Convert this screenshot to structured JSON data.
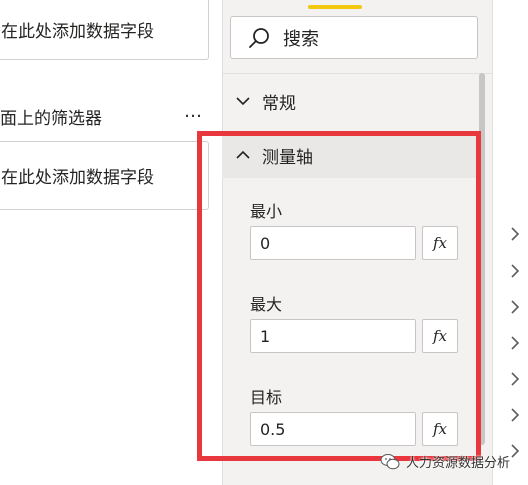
{
  "filters_pane": {
    "drop_zone_1": "在此处添加数据字段",
    "section_title": "面上的筛选器",
    "more_label": "…",
    "drop_zone_2": "在此处添加数据字段"
  },
  "format_pane": {
    "search_placeholder": "搜索",
    "sections": {
      "general": "常规",
      "measure_axis": "测量轴"
    },
    "fields": {
      "min_label": "最小",
      "min_value": "0",
      "max_label": "最大",
      "max_value": "1",
      "target_label": "目标",
      "target_value": "0.5"
    },
    "fx_label": "fx"
  },
  "watermark": "人力资源数据分析",
  "colors": {
    "highlight": "#e8383d",
    "accent": "#f2c811",
    "pane_bg": "#f3f2f1"
  }
}
